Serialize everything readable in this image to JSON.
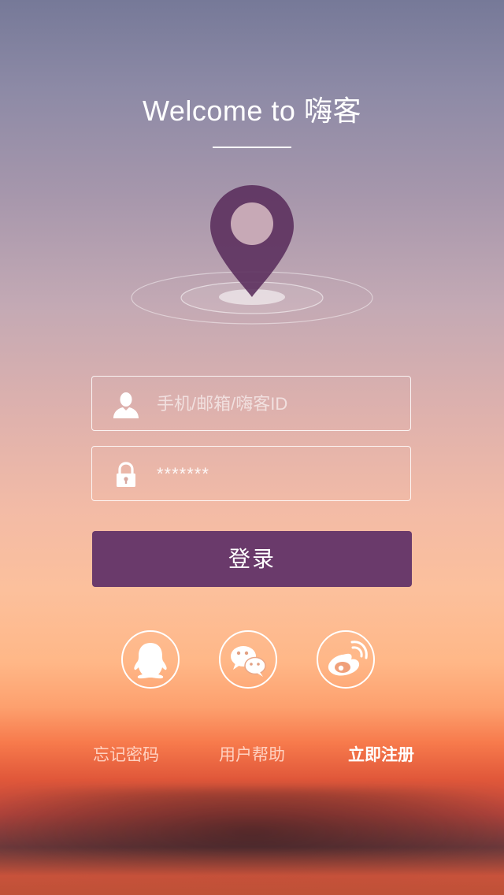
{
  "header": {
    "title": "Welcome to 嗨客"
  },
  "login_form": {
    "username": {
      "placeholder": "手机/邮箱/嗨客ID",
      "icon": "user-icon"
    },
    "password": {
      "value": "*******",
      "icon": "lock-icon"
    },
    "submit_label": "登录"
  },
  "social_login": {
    "items": [
      {
        "name": "qq",
        "icon": "qq-icon"
      },
      {
        "name": "wechat",
        "icon": "wechat-icon"
      },
      {
        "name": "weibo",
        "icon": "weibo-icon"
      }
    ]
  },
  "footer": {
    "forgot_password": "忘记密码",
    "user_help": "用户帮助",
    "register_now": "立即注册"
  },
  "colors": {
    "accent": "#6a3a6b",
    "pin": "#5b2f5e",
    "text": "#ffffff"
  }
}
